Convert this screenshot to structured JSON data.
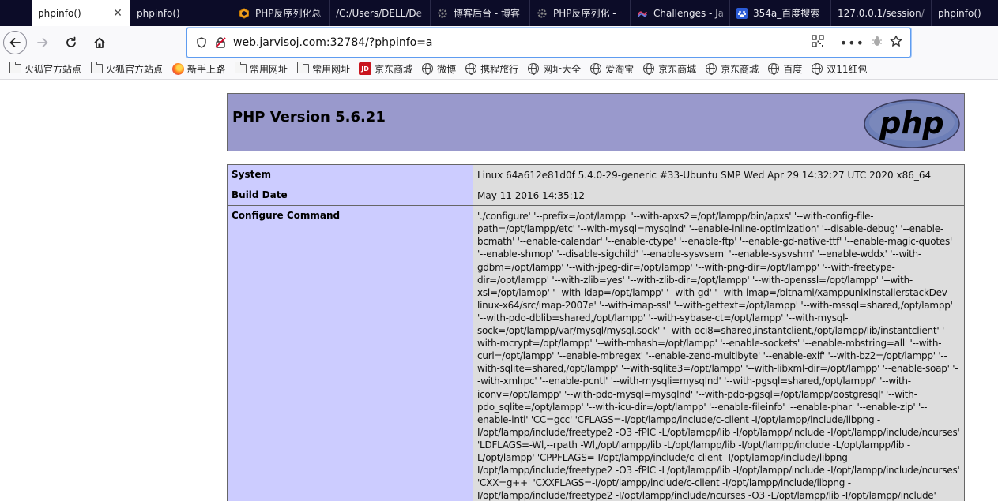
{
  "browser": {
    "tabs": [
      {
        "label": "phpinfo()",
        "icon": "none",
        "active": true
      },
      {
        "label": "phpinfo()",
        "icon": "none",
        "active": false
      },
      {
        "label": "PHP反序列化总",
        "icon": "hex-icon",
        "active": false
      },
      {
        "label": "/C:/Users/DELL/De",
        "icon": "none",
        "active": false
      },
      {
        "label": "博客后台 - 博客",
        "icon": "gear-icon",
        "active": false
      },
      {
        "label": "PHP反序列化 -",
        "icon": "gear-icon",
        "active": false
      },
      {
        "label": "Challenges - Ja",
        "icon": "swirl-icon",
        "active": false
      },
      {
        "label": "354a_百度搜索",
        "icon": "paw-icon",
        "active": false
      },
      {
        "label": "127.0.0.1/session/",
        "icon": "none",
        "active": false
      },
      {
        "label": "phpinfo()",
        "icon": "none",
        "active": false
      }
    ],
    "url": "web.jarvisoj.com:32784/?phpinfo=a",
    "bookmarks": [
      {
        "label": "火狐官方站点",
        "icon": "folder"
      },
      {
        "label": "火狐官方站点",
        "icon": "folder"
      },
      {
        "label": "新手上路",
        "icon": "firefox"
      },
      {
        "label": "常用网址",
        "icon": "folder"
      },
      {
        "label": "常用网址",
        "icon": "folder"
      },
      {
        "label": "京东商城",
        "icon": "jd"
      },
      {
        "label": "微博",
        "icon": "globe"
      },
      {
        "label": "携程旅行",
        "icon": "globe"
      },
      {
        "label": "网址大全",
        "icon": "globe"
      },
      {
        "label": "爱淘宝",
        "icon": "globe"
      },
      {
        "label": "京东商城",
        "icon": "globe"
      },
      {
        "label": "京东商城",
        "icon": "globe"
      },
      {
        "label": "百度",
        "icon": "globe"
      },
      {
        "label": "双11红包",
        "icon": "globe"
      }
    ],
    "jd_icon_text": "JD"
  },
  "page": {
    "title": "PHP Version 5.6.21",
    "logo_text": "php",
    "rows": [
      {
        "key": "System",
        "value": "Linux 64a612e81d0f 5.4.0-29-generic #33-Ubuntu SMP Wed Apr 29 14:32:27 UTC 2020 x86_64"
      },
      {
        "key": "Build Date",
        "value": "May 11 2016 14:35:12"
      },
      {
        "key": "Configure Command",
        "value": "'./configure' '--prefix=/opt/lampp' '--with-apxs2=/opt/lampp/bin/apxs' '--with-config-file-path=/opt/lampp/etc' '--with-mysql=mysqlnd' '--enable-inline-optimization' '--disable-debug' '--enable-bcmath' '--enable-calendar' '--enable-ctype' '--enable-ftp' '--enable-gd-native-ttf' '--enable-magic-quotes' '--enable-shmop' '--disable-sigchild' '--enable-sysvsem' '--enable-sysvshm' '--enable-wddx' '--with-gdbm=/opt/lampp' '--with-jpeg-dir=/opt/lampp' '--with-png-dir=/opt/lampp' '--with-freetype-dir=/opt/lampp' '--with-zlib=yes' '--with-zlib-dir=/opt/lampp' '--with-openssl=/opt/lampp' '--with-xsl=/opt/lampp' '--with-ldap=/opt/lampp' '--with-gd' '--with-imap=/bitnami/xamppunixinstallerstackDev-linux-x64/src/imap-2007e' '--with-imap-ssl' '--with-gettext=/opt/lampp' '--with-mssql=shared,/opt/lampp' '--with-pdo-dblib=shared,/opt/lampp' '--with-sybase-ct=/opt/lampp' '--with-mysql-sock=/opt/lampp/var/mysql/mysql.sock' '--with-oci8=shared,instantclient,/opt/lampp/lib/instantclient' '--with-mcrypt=/opt/lampp' '--with-mhash=/opt/lampp' '--enable-sockets' '--enable-mbstring=all' '--with-curl=/opt/lampp' '--enable-mbregex' '--enable-zend-multibyte' '--enable-exif' '--with-bz2=/opt/lampp' '--with-sqlite=shared,/opt/lampp' '--with-sqlite3=/opt/lampp' '--with-libxml-dir=/opt/lampp' '--enable-soap' '--with-xmlrpc' '--enable-pcntl' '--with-mysqli=mysqlnd' '--with-pgsql=shared,/opt/lampp/' '--with-iconv=/opt/lampp' '--with-pdo-mysql=mysqlnd' '--with-pdo-pgsql=/opt/lampp/postgresql' '--with-pdo_sqlite=/opt/lampp' '--with-icu-dir=/opt/lampp' '--enable-fileinfo' '--enable-phar' '--enable-zip' '--enable-intl' 'CC=gcc' 'CFLAGS=-I/opt/lampp/include/c-client -I/opt/lampp/include/libpng -I/opt/lampp/include/freetype2 -O3 -fPIC -L/opt/lampp/lib -I/opt/lampp/include -I/opt/lampp/include/ncurses' 'LDFLAGS=-Wl,--rpath -Wl,/opt/lampp/lib -L/opt/lampp/lib -I/opt/lampp/include -L/opt/lampp/lib -L/opt/lampp' 'CPPFLAGS=-I/opt/lampp/include/c-client -I/opt/lampp/include/libpng -I/opt/lampp/include/freetype2 -O3 -fPIC -L/opt/lampp/lib -I/opt/lampp/include -I/opt/lampp/include/ncurses' 'CXX=g++' 'CXXFLAGS=-I/opt/lampp/include/c-client -I/opt/lampp/include/libpng -I/opt/lampp/include/freetype2 -I/opt/lampp/include/ncurses -O3 -L/opt/lampp/lib -I/opt/lampp/include'"
      }
    ]
  },
  "colors": {
    "header_bg": "#9999cc",
    "key_bg": "#ccccff",
    "value_bg": "#dddddd",
    "tabstrip_bg": "#0c0c28",
    "url_focus": "#5e9cf0"
  }
}
